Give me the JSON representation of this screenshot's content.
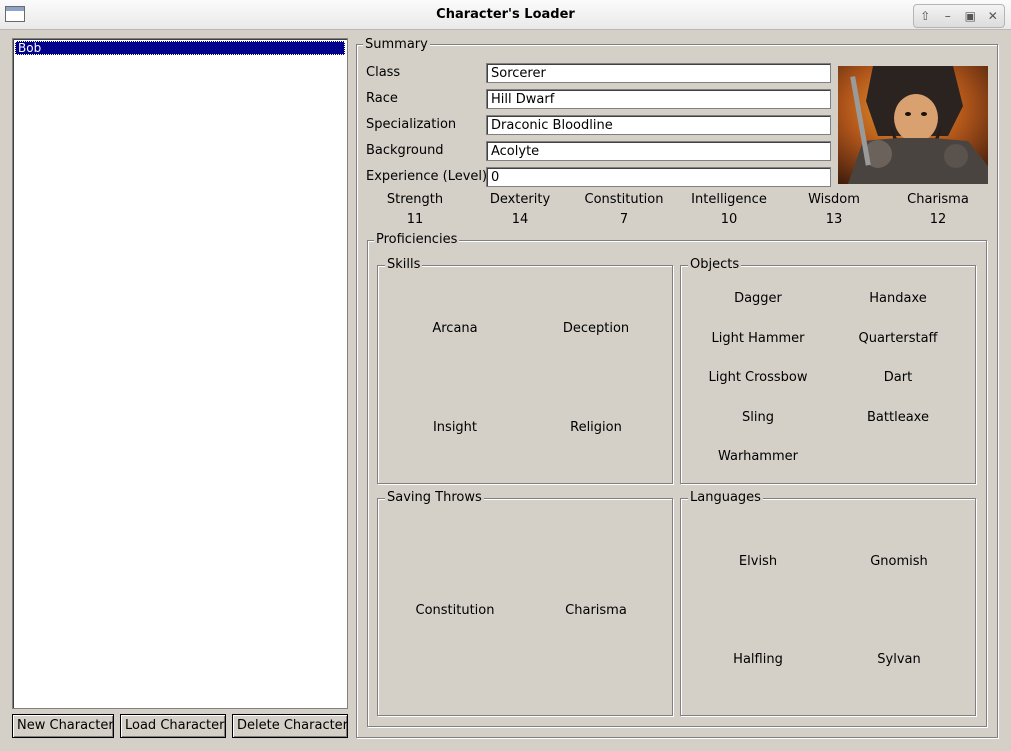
{
  "window": {
    "title": "Character's Loader"
  },
  "characters": [
    "Bob"
  ],
  "buttons": {
    "new": "New Character",
    "load": "Load Character",
    "delete": "Delete Character"
  },
  "summary": {
    "label": "Summary",
    "fields": {
      "class_label": "Class",
      "class_value": "Sorcerer",
      "race_label": "Race",
      "race_value": "Hill Dwarf",
      "spec_label": "Specialization",
      "spec_value": "Draconic Bloodline",
      "background_label": "Background",
      "background_value": "Acolyte",
      "exp_label": "Experience (Level)",
      "exp_value": "0"
    },
    "stats": {
      "str_label": "Strength",
      "str_value": "11",
      "dex_label": "Dexterity",
      "dex_value": "14",
      "con_label": "Constitution",
      "con_value": "7",
      "int_label": "Intelligence",
      "int_value": "10",
      "wis_label": "Wisdom",
      "wis_value": "13",
      "cha_label": "Charisma",
      "cha_value": "12"
    }
  },
  "proficiencies": {
    "label": "Proficiencies",
    "skills": {
      "label": "Skills",
      "items": [
        "Arcana",
        "Deception",
        "Insight",
        "Religion"
      ]
    },
    "objects": {
      "label": "Objects",
      "items": [
        "Dagger",
        "Handaxe",
        "Light Hammer",
        "Quarterstaff",
        "Light Crossbow",
        "Dart",
        "Sling",
        "Battleaxe",
        "Warhammer"
      ]
    },
    "saving_throws": {
      "label": "Saving Throws",
      "items": [
        "Constitution",
        "Charisma"
      ]
    },
    "languages": {
      "label": "Languages",
      "items": [
        "Elvish",
        "Gnomish",
        "Halfling",
        "Sylvan"
      ]
    }
  },
  "colors": {
    "window_bg": "#d4d0c8",
    "selection": "#00008b"
  },
  "icons": [
    "app-window-icon",
    "shade-icon",
    "minimize-icon",
    "maximize-icon",
    "close-icon",
    "character-portrait"
  ]
}
